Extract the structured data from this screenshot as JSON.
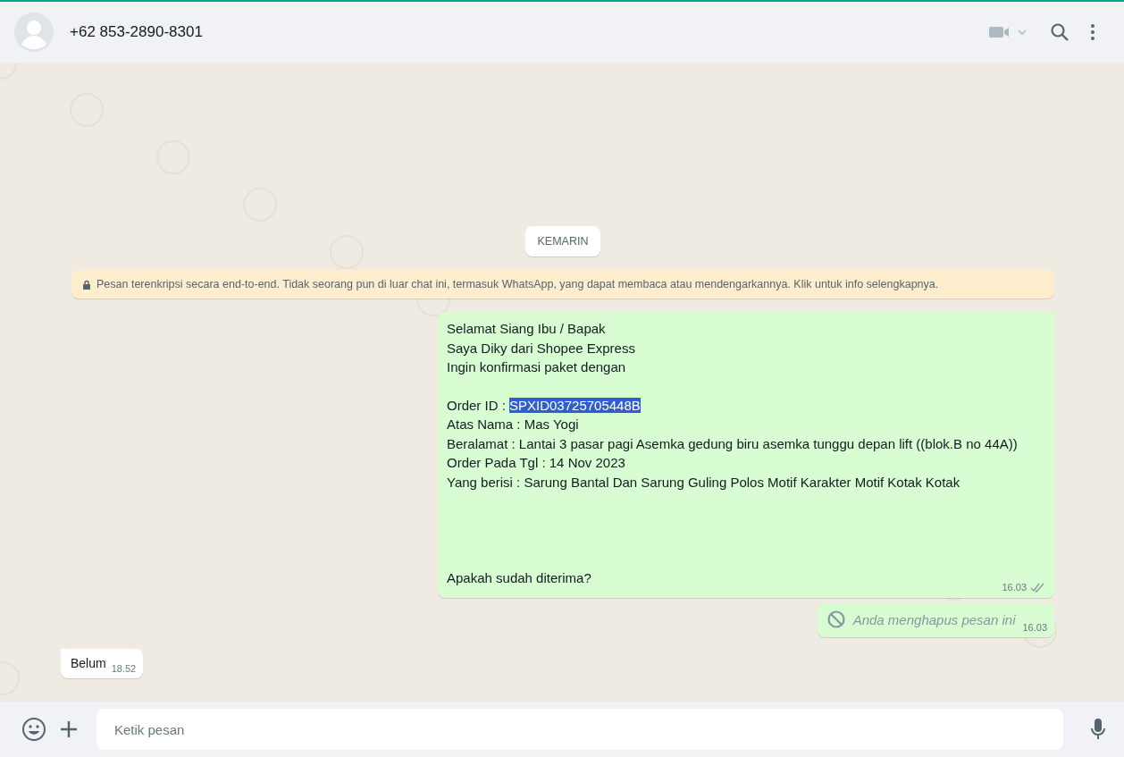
{
  "header": {
    "contact": "+62 853-2890-8301"
  },
  "date_chip": "KEMARIN",
  "encryption_notice": "Pesan terenkripsi secara end-to-end. Tidak seorang pun di luar chat ini, termasuk WhatsApp, yang dapat membaca atau mendengarkannya. Klik untuk info selengkapnya.",
  "messages": [
    {
      "kind": "outgoing",
      "time": "16.03",
      "read": false,
      "lines": [
        {
          "kind": "line",
          "text": "Selamat Siang Ibu / Bapak"
        },
        {
          "kind": "line",
          "text": "Saya Diky dari Shopee Express"
        },
        {
          "kind": "line",
          "text": "Ingin konfirmasi paket dengan"
        },
        {
          "kind": "blank"
        },
        {
          "kind": "line",
          "text": "Order ID : ",
          "selected_text": "SPXID03725705448B"
        },
        {
          "kind": "line",
          "text": "Atas Nama : Mas Yogi"
        },
        {
          "kind": "line",
          "text": "Beralamat : Lantai 3 pasar pagi Asemka gedung biru asemka tunggu depan lift ((blok.B no 44A))"
        },
        {
          "kind": "line",
          "text": "Order Pada Tgl : 14 Nov 2023"
        },
        {
          "kind": "line",
          "text": "Yang berisi : Sarung Bantal Dan Sarung Guling Polos Motif Karakter Motif Kotak Kotak"
        },
        {
          "kind": "blank"
        },
        {
          "kind": "blank"
        },
        {
          "kind": "blank"
        },
        {
          "kind": "blank"
        },
        {
          "kind": "line",
          "text": "Apakah sudah diterima?"
        }
      ]
    },
    {
      "kind": "deleted",
      "time": "16.03",
      "text": "Anda menghapus pesan ini"
    },
    {
      "kind": "incoming",
      "time": "18.52",
      "text": "Belum"
    }
  ],
  "composer": {
    "placeholder": "Ketik pesan"
  }
}
